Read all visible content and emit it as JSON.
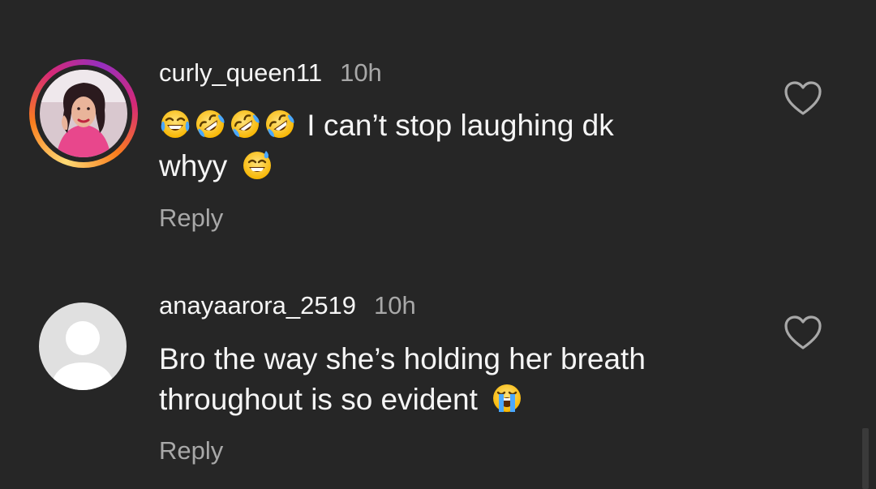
{
  "comments": [
    {
      "username": "curly_queen11",
      "time": "10h",
      "emojis_prefix": [
        "face-with-tears-of-joy",
        "rolling-on-floor-laughing",
        "rolling-on-floor-laughing",
        "rolling-on-floor-laughing"
      ],
      "text_part1": "I can’t stop laughing dk",
      "text_part2": "whyy",
      "emoji_suffix": "grinning-face-with-sweat",
      "reply_label": "Reply",
      "avatar": "profile-photo",
      "liked": false
    },
    {
      "username": "anayaarora_2519",
      "time": "10h",
      "text_part1": "Bro the way she’s holding her breath",
      "text_part2": "throughout is so evident",
      "emoji_suffix": "loudly-crying-face",
      "reply_label": "Reply",
      "avatar": "default-avatar",
      "liked": false
    }
  ],
  "colors": {
    "background": "#262626",
    "primary_text": "#f5f5f5",
    "secondary_text": "#a8a8a8",
    "story_ring": [
      "#feda75",
      "#fa7e1e",
      "#d62976",
      "#962fbf"
    ]
  }
}
